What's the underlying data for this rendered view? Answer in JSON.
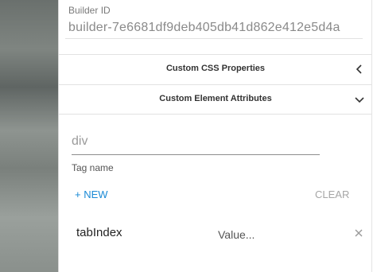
{
  "builder": {
    "label": "Builder ID",
    "value": "builder-7e6681df9deb405db41d862e412e5d4a"
  },
  "sections": [
    {
      "title": "Custom CSS Properties",
      "icon": "chevron-left-icon"
    },
    {
      "title": "Custom Element Attributes",
      "icon": "chevron-down-icon"
    }
  ],
  "tag": {
    "placeholder": "div",
    "label": "Tag name"
  },
  "actions": {
    "new_label": "+ NEW",
    "clear_label": "CLEAR"
  },
  "attributes": [
    {
      "name": "tabIndex",
      "value_placeholder": "Value...",
      "remove_icon": "close-icon"
    }
  ],
  "colors": {
    "accent": "#1a8ad6",
    "muted": "#a6a6a6",
    "divider": "#e2e2e2"
  }
}
